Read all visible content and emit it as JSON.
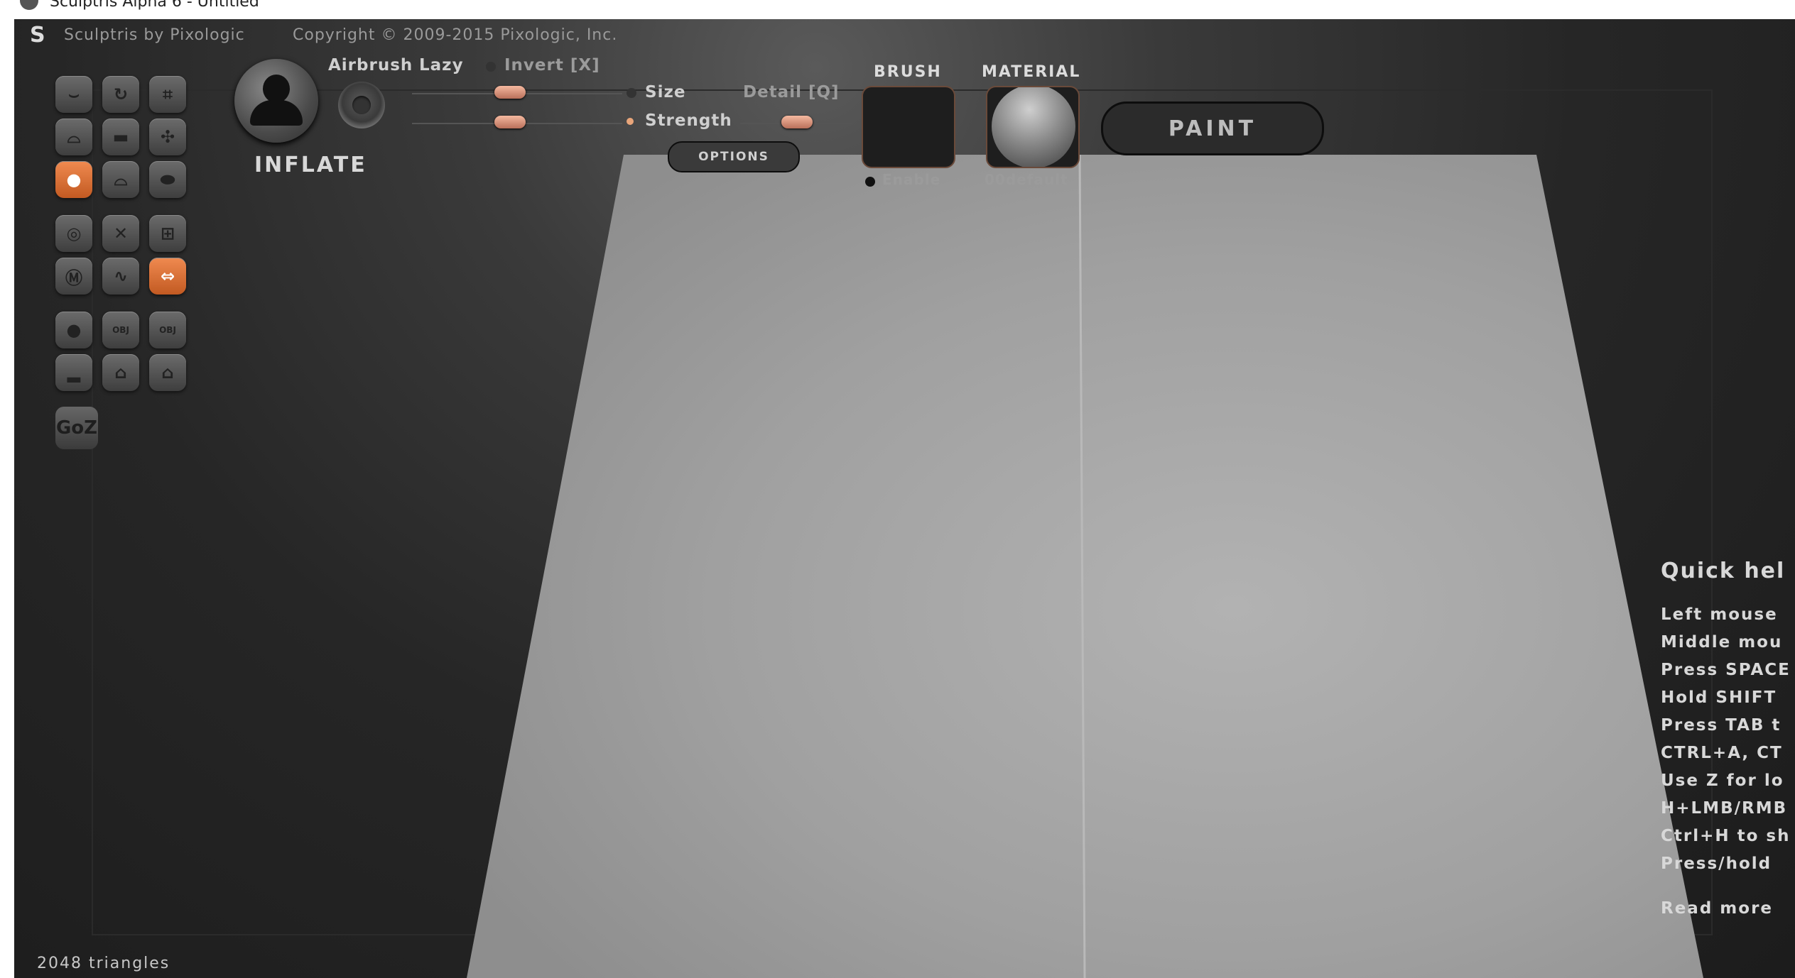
{
  "window": {
    "title": "Sculptris Alpha 6 - Untitled"
  },
  "header": {
    "brand": "Sculptris by Pixologic",
    "copyright": "Copyright © 2009-2015 Pixologic, Inc."
  },
  "toolbar": {
    "buttons": [
      {
        "name": "crease-tool",
        "icon": "crease-icon",
        "active": false
      },
      {
        "name": "rotate-tool",
        "icon": "rotate-icon",
        "active": false
      },
      {
        "name": "scale-tool",
        "icon": "crop-icon",
        "active": false
      },
      {
        "name": "draw-tool",
        "icon": "draw-icon",
        "active": false
      },
      {
        "name": "flatten-tool",
        "icon": "flatten-icon",
        "active": false
      },
      {
        "name": "grab-tool",
        "icon": "move-icon",
        "active": false
      },
      {
        "name": "inflate-tool",
        "icon": "inflate-icon",
        "active": true
      },
      {
        "name": "pinch-tool",
        "icon": "pinch-icon",
        "active": false
      },
      {
        "name": "smooth-tool",
        "icon": "smooth-icon",
        "active": false
      },
      {
        "name": "symmetry-toggle",
        "icon": "symmetry-icon",
        "active": false
      },
      {
        "name": "wireframe-toggle",
        "icon": "wireframe-icon",
        "active": false
      },
      {
        "name": "grid-toggle",
        "icon": "grid-icon",
        "active": false
      },
      {
        "name": "mask-toggle",
        "icon": "mask-icon",
        "active": false
      },
      {
        "name": "reduce-toggle",
        "icon": "reduce-icon",
        "active": false
      },
      {
        "name": "mirror-toggle",
        "icon": "mirror-icon",
        "active": true
      },
      {
        "name": "new-sphere-button",
        "icon": "sphere-icon",
        "active": false
      },
      {
        "name": "import-obj-button",
        "icon": "obj-import-icon",
        "label": "OBJ",
        "active": false
      },
      {
        "name": "export-obj-button",
        "icon": "obj-export-icon",
        "label": "OBJ",
        "active": false
      },
      {
        "name": "new-plane-button",
        "icon": "plane-icon",
        "active": false
      },
      {
        "name": "open-button",
        "icon": "open-icon",
        "active": false
      },
      {
        "name": "save-button",
        "icon": "save-icon",
        "active": false
      }
    ],
    "goz_label": "GoZ"
  },
  "tool": {
    "name": "INFLATE",
    "airbrush_label": "Airbrush",
    "lazy_label": "Lazy",
    "invert_label": "Invert [X]",
    "size_label": "Size",
    "detail_label": "Detail [Q]",
    "strength_label": "Strength",
    "options_label": "OPTIONS"
  },
  "brush": {
    "title": "BRUSH",
    "enable_label": "Enable"
  },
  "material": {
    "title": "MATERIAL",
    "name": "00default"
  },
  "paint_label": "PAINT",
  "quick_help": {
    "title": "Quick hel",
    "lines": [
      "Left mouse",
      "Middle mou",
      "Press SPACE",
      "Hold SHIFT",
      "Press TAB t",
      "CTRL+A, CT",
      "Use Z for lo",
      "H+LMB/RMB",
      "Ctrl+H to sh",
      "Press/hold"
    ],
    "read_more": "Read more"
  },
  "status": {
    "triangles": "2048 triangles"
  },
  "colors": {
    "accent": "#e07a3f",
    "background": "#262626",
    "plane": "#a8a8a8"
  }
}
